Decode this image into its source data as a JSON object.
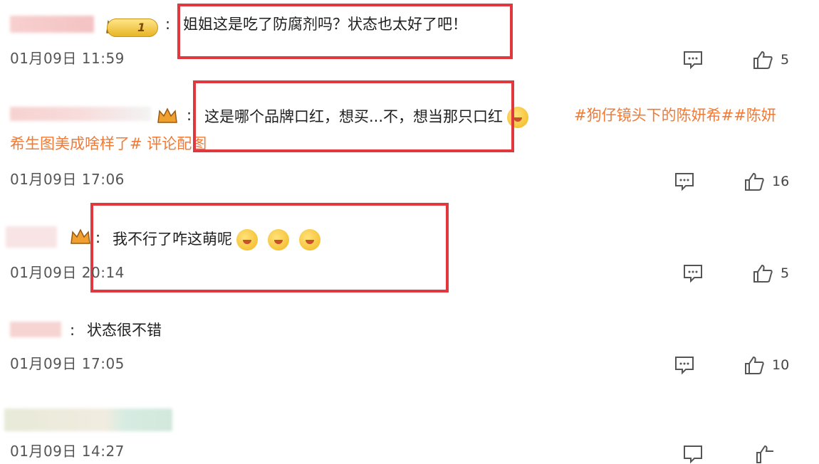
{
  "comments": [
    {
      "separator": ":",
      "text": "姐姐这是吃了防腐剂吗？状态也太好了吧！",
      "badge_text": "1",
      "time": "01月09日 11:59",
      "likes": "5"
    },
    {
      "separator": ":",
      "text": "这是哪个品牌口红，想买...不，想当那只口红",
      "tag": "#狗仔镜头下的陈妍希##陈妍",
      "tag2": "希生图美成啥样了# 评论配图",
      "time": "01月09日 17:06",
      "likes": "16"
    },
    {
      "separator": ":",
      "text": "我不行了咋这萌呢",
      "time": "01月09日 20:14",
      "likes": "5"
    },
    {
      "separator": ":",
      "text": "状态很不错",
      "time": "01月09日 17:05",
      "likes": "10"
    },
    {
      "time": "01月09日 14:27"
    }
  ],
  "colors": {
    "highlight_box": "#e0383e",
    "topic_tag": "#f07a36"
  },
  "icons": {
    "reply": "comment-icon",
    "like": "thumbs-up-icon"
  }
}
